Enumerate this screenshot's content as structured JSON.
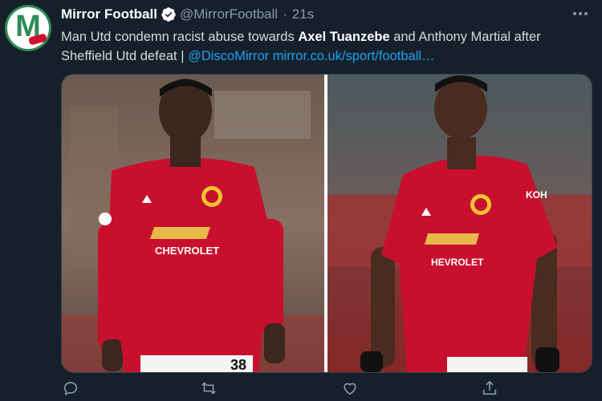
{
  "account": {
    "display_name": "Mirror Football",
    "handle": "@MirrorFootball",
    "separator": "·",
    "time": "21s",
    "avatar_letter": "M"
  },
  "tweet": {
    "text_1": "Man Utd condemn racist abuse towards ",
    "bold_1": "Axel Tuanzebe",
    "text_2": " and Anthony Martial after Sheffield Utd defeat | ",
    "mention": "@DiscoMirror",
    "text_3": " ",
    "url": "mirror.co.uk/sport/football…"
  },
  "media": {
    "left_sponsor": "CHEVROLET",
    "right_sponsor": "HEVROLET",
    "right_sleeve": "KOH",
    "left_number": "38"
  },
  "icons": {
    "verified": "verified-badge-icon",
    "more": "more-options-icon",
    "reply": "reply-icon",
    "retweet": "retweet-icon",
    "like": "like-icon",
    "share": "share-icon"
  },
  "colors": {
    "background": "#15202b",
    "link": "#1da1f2",
    "secondary_text": "#8899a6",
    "kit_red": "#c8102e"
  }
}
